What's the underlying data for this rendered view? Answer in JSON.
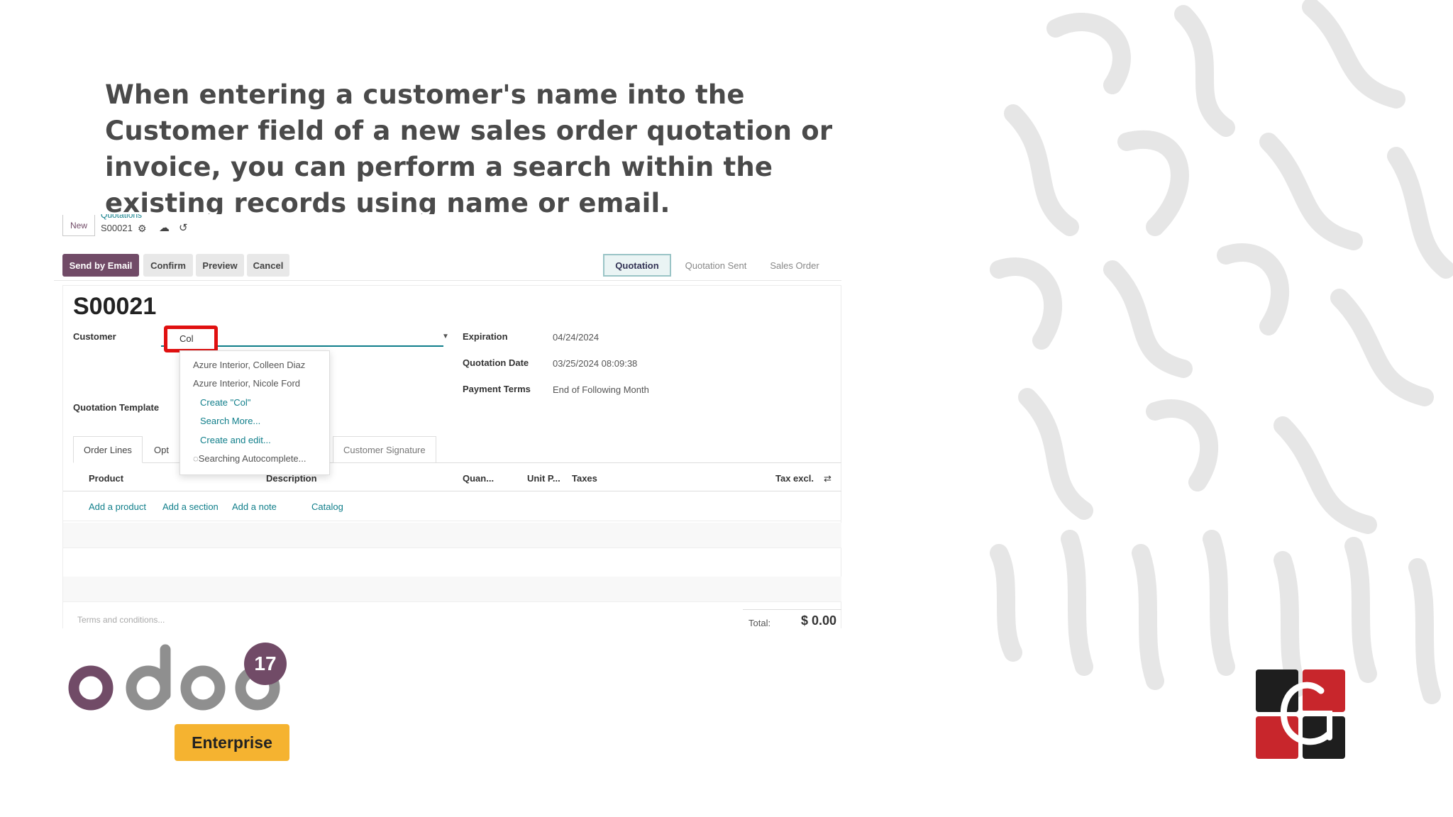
{
  "caption": "When entering a customer's name into the Customer field of a new sales order quotation or invoice, you can perform a search within the existing records using name or email.",
  "topbar": {
    "new_label": "New",
    "breadcrumb_parent": "Quotations",
    "breadcrumb_current": "S00021"
  },
  "actions": {
    "send_email": "Send by Email",
    "confirm": "Confirm",
    "preview": "Preview",
    "cancel": "Cancel"
  },
  "statusbar": [
    "Quotation",
    "Quotation Sent",
    "Sales Order"
  ],
  "form": {
    "title": "S00021",
    "customer_label": "Customer",
    "customer_value": "Col",
    "quotation_template_label": "Quotation Template",
    "expiration_label": "Expiration",
    "expiration_value": "04/24/2024",
    "quotation_date_label": "Quotation Date",
    "quotation_date_value": "03/25/2024 08:09:38",
    "payment_terms_label": "Payment Terms",
    "payment_terms_value": "End of Following Month"
  },
  "dropdown": {
    "records": [
      "Azure Interior, Colleen Diaz",
      "Azure Interior, Nicole Ford"
    ],
    "create": "Create \"Col\"",
    "search_more": "Search More...",
    "create_edit": "Create and edit...",
    "searching": "Searching Autocomplete..."
  },
  "tabs": {
    "order_lines": "Order Lines",
    "optional": "Opt",
    "signature": "Customer Signature"
  },
  "table_headers": {
    "product": "Product",
    "description": "Description",
    "quantity": "Quan...",
    "unit_price": "Unit P...",
    "taxes": "Taxes",
    "tax_excl": "Tax excl."
  },
  "add_links": {
    "product": "Add a product",
    "section": "Add a section",
    "note": "Add a note",
    "catalog": "Catalog"
  },
  "footer": {
    "terms_placeholder": "Terms and conditions...",
    "total_label": "Total:",
    "total_value": "$ 0.00"
  },
  "branding": {
    "odoo_wordmark": "odoo",
    "version_badge": "17",
    "edition": "Enterprise"
  },
  "colors": {
    "odoo_purple": "#714b67",
    "odoo_grey": "#8f8f8f",
    "teal": "#0f7e8a",
    "highlight_red": "#e01010",
    "enterprise_yellow": "#f5b330",
    "cg_red": "#c8262c",
    "cg_black": "#1e1e1e"
  }
}
